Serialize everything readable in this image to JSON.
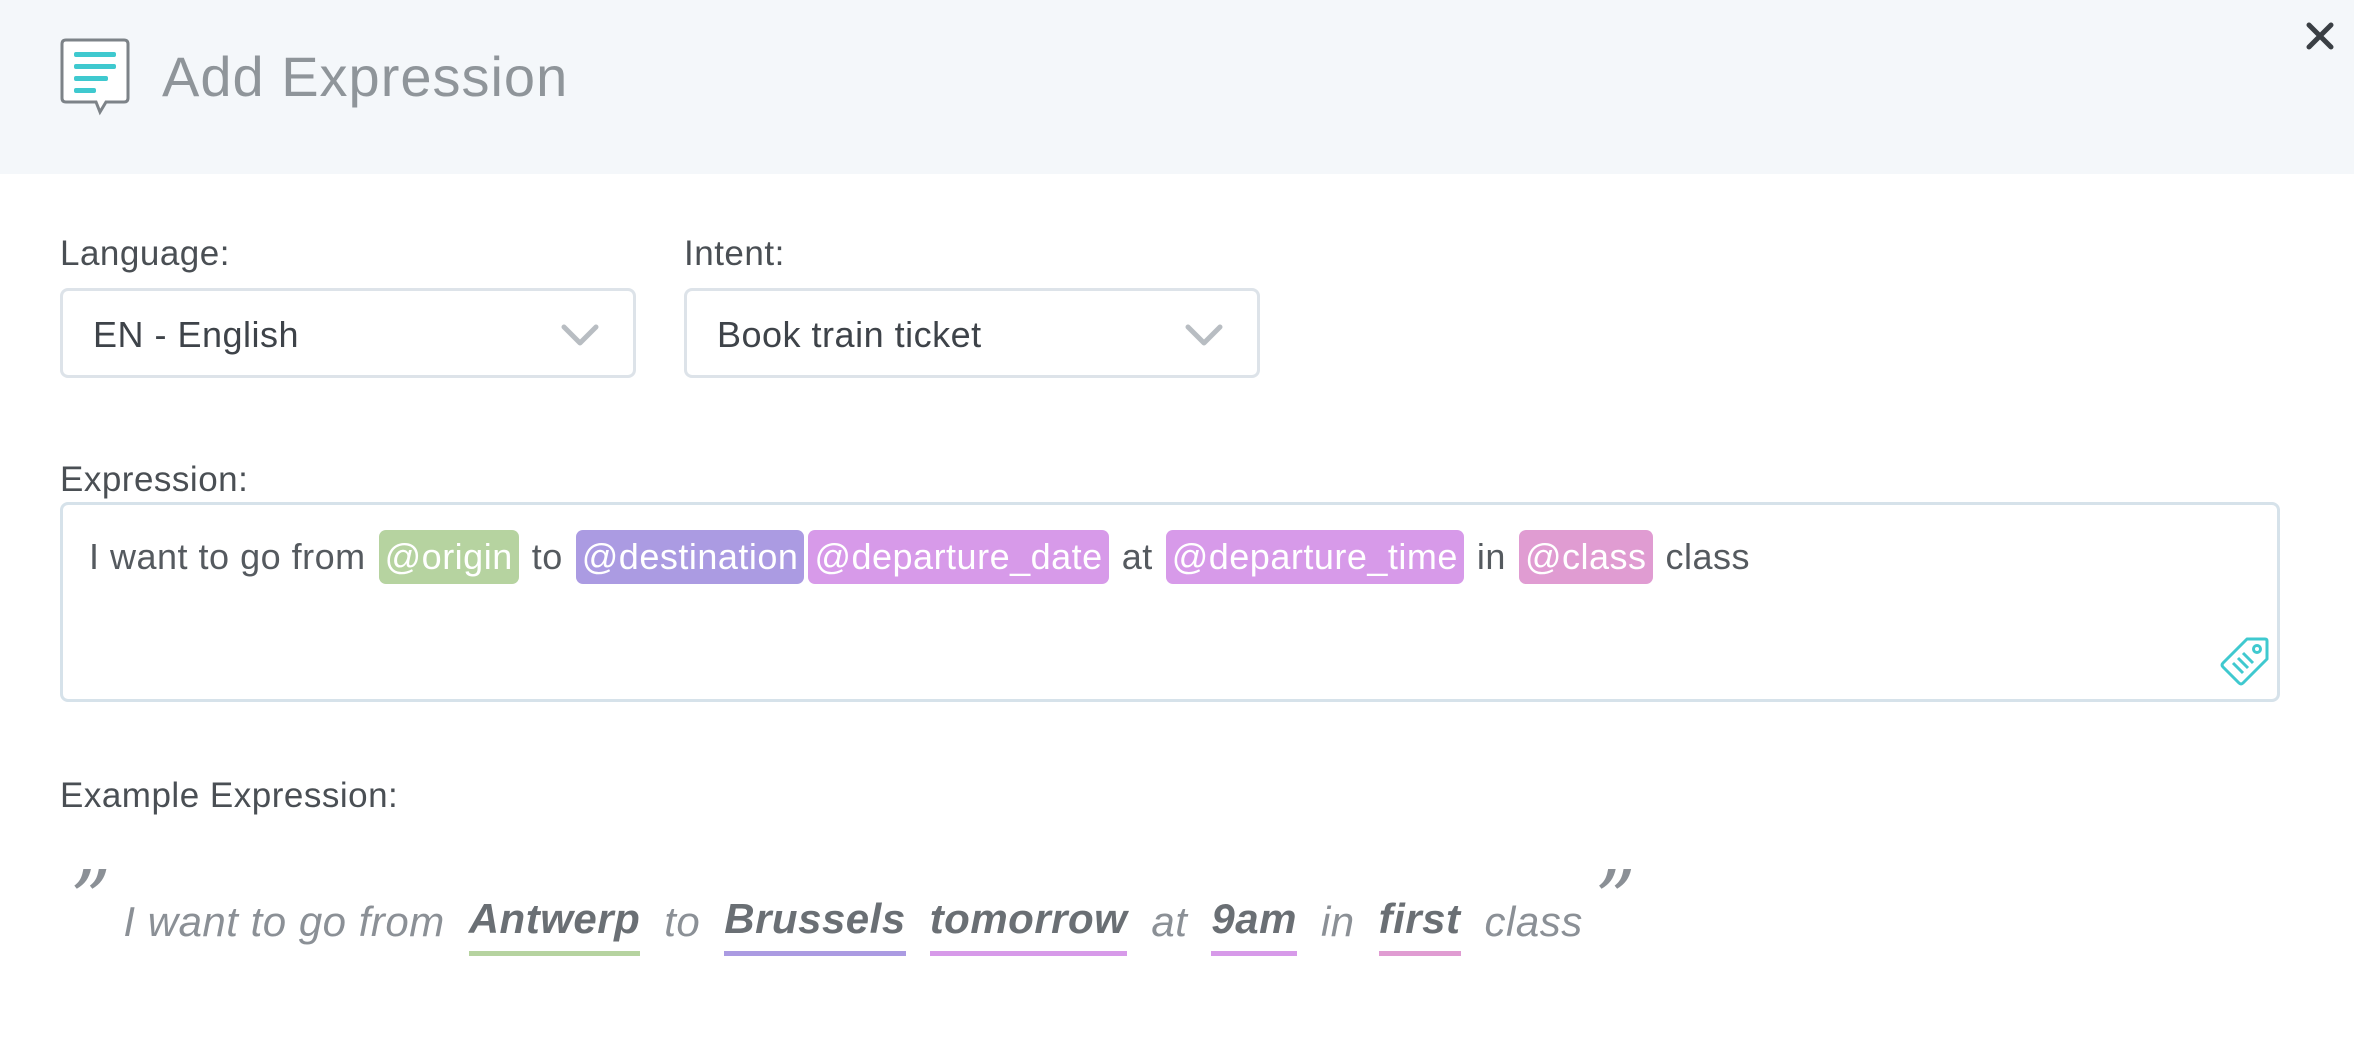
{
  "dialog": {
    "title": "Add Expression",
    "close_icon": "close-icon",
    "header_icon": "speech-document-icon"
  },
  "language": {
    "label": "Language:",
    "value": "EN - English"
  },
  "intent": {
    "label": "Intent:",
    "value": "Book train ticket"
  },
  "expression": {
    "label": "Expression:",
    "tokens": [
      {
        "text": "I want to go from",
        "entity": false
      },
      {
        "text": "@origin",
        "entity": true,
        "color": "#b6d3a0"
      },
      {
        "text": "to",
        "entity": false
      },
      {
        "text": "@destination",
        "entity": true,
        "color": "#ab9be2"
      },
      {
        "text": "@departure_date",
        "entity": true,
        "color": "#d79ae9"
      },
      {
        "text": "at",
        "entity": false
      },
      {
        "text": "@departure_time",
        "entity": true,
        "color": "#d79ae9"
      },
      {
        "text": "in",
        "entity": false
      },
      {
        "text": "@class",
        "entity": true,
        "color": "#e09cd2"
      },
      {
        "text": "class",
        "entity": false
      }
    ],
    "label_button_icon": "tag-icon"
  },
  "example": {
    "label": "Example Expression:",
    "open_quote": "”",
    "close_quote": "”",
    "tokens": [
      {
        "text": "I want to go from",
        "entity": false
      },
      {
        "text": "Antwerp",
        "entity": true,
        "color": "#b6d3a0"
      },
      {
        "text": "to",
        "entity": false
      },
      {
        "text": "Brussels",
        "entity": true,
        "color": "#ab9be2"
      },
      {
        "text": "tomorrow",
        "entity": true,
        "color": "#d79ae9"
      },
      {
        "text": "at",
        "entity": false
      },
      {
        "text": "9am",
        "entity": true,
        "color": "#d79ae9"
      },
      {
        "text": "in",
        "entity": false
      },
      {
        "text": "first",
        "entity": true,
        "color": "#e09cd2"
      },
      {
        "text": "class",
        "entity": false
      }
    ]
  },
  "colors": {
    "accent": "#3fc9cf",
    "header_bg": "#f4f7fa"
  }
}
